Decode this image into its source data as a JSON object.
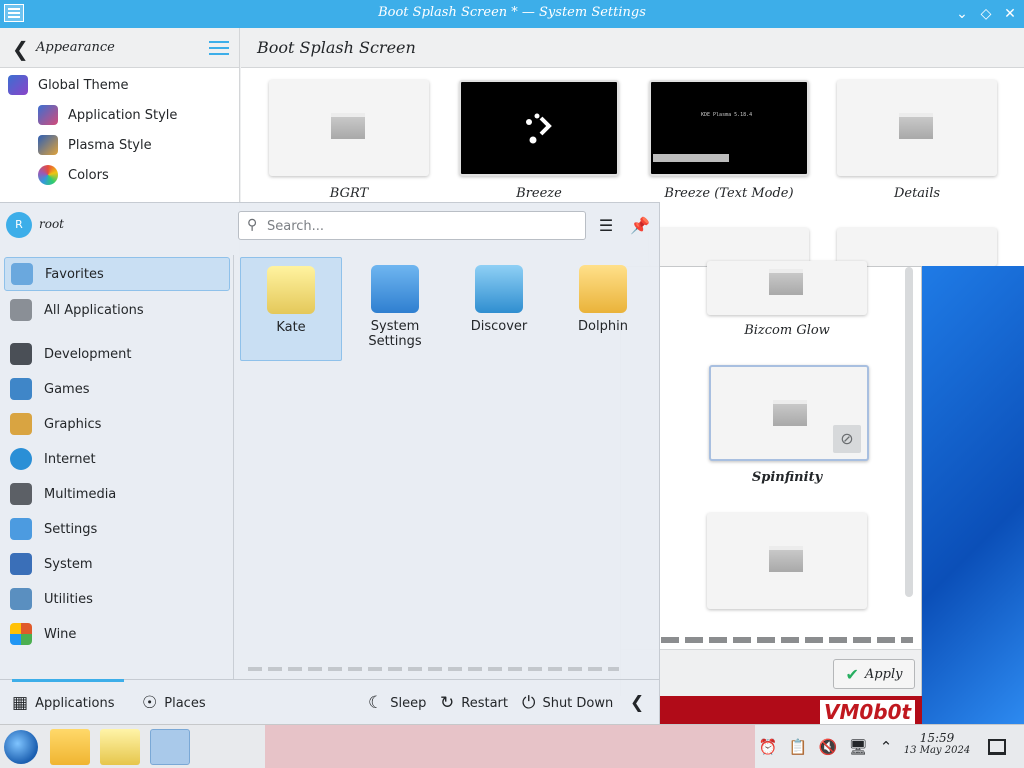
{
  "window": {
    "title": "Boot Splash Screen * — System Settings"
  },
  "sidebar": {
    "back_label": "Appearance",
    "items": [
      {
        "label": "Global Theme"
      },
      {
        "label": "Application Style"
      },
      {
        "label": "Plasma Style"
      },
      {
        "label": "Colors"
      }
    ]
  },
  "content": {
    "title": "Boot Splash Screen",
    "themes": [
      {
        "label": "BGRT"
      },
      {
        "label": "Breeze"
      },
      {
        "label": "Breeze (Text Mode)",
        "preview_text": "KDE Plasma 5.18.4"
      },
      {
        "label": "Details"
      }
    ]
  },
  "panel": {
    "themes": [
      {
        "label": "Bizcom Glow"
      },
      {
        "label": "Spinfinity"
      }
    ],
    "apply_label": "Apply"
  },
  "launcher": {
    "avatar_letter": "R",
    "user": "root",
    "search_placeholder": "Search...",
    "categories": [
      {
        "label": "Favorites",
        "color": "#6aa8de"
      },
      {
        "label": "All Applications",
        "color": "#8a8f96"
      },
      {
        "label": "Development",
        "color": "#4a4f56"
      },
      {
        "label": "Games",
        "color": "#3f86c8"
      },
      {
        "label": "Graphics",
        "color": "#d9a441"
      },
      {
        "label": "Internet",
        "color": "#2a8fd6"
      },
      {
        "label": "Multimedia",
        "color": "#5c6066"
      },
      {
        "label": "Settings",
        "color": "#4c9be0"
      },
      {
        "label": "System",
        "color": "#3a6fb8"
      },
      {
        "label": "Utilities",
        "color": "#5a8fc0"
      },
      {
        "label": "Wine",
        "color": "#e05a2a"
      }
    ],
    "apps": [
      {
        "label": "Kate",
        "color": "#e8d36a"
      },
      {
        "label": "System Settings",
        "color": "#4b9de6"
      },
      {
        "label": "Discover",
        "color": "#3aa0d8"
      },
      {
        "label": "Dolphin",
        "color": "#f2c24b"
      }
    ],
    "footer": {
      "applications": "Applications",
      "places": "Places",
      "sleep": "Sleep",
      "restart": "Restart",
      "shutdown": "Shut Down"
    }
  },
  "taskbar": {
    "time": "15:59",
    "date": "13 May 2024"
  },
  "desktop": {
    "watermark": "VM0b0t"
  },
  "colors": {
    "accent": "#3daee9",
    "selection": "#c9dff3"
  }
}
